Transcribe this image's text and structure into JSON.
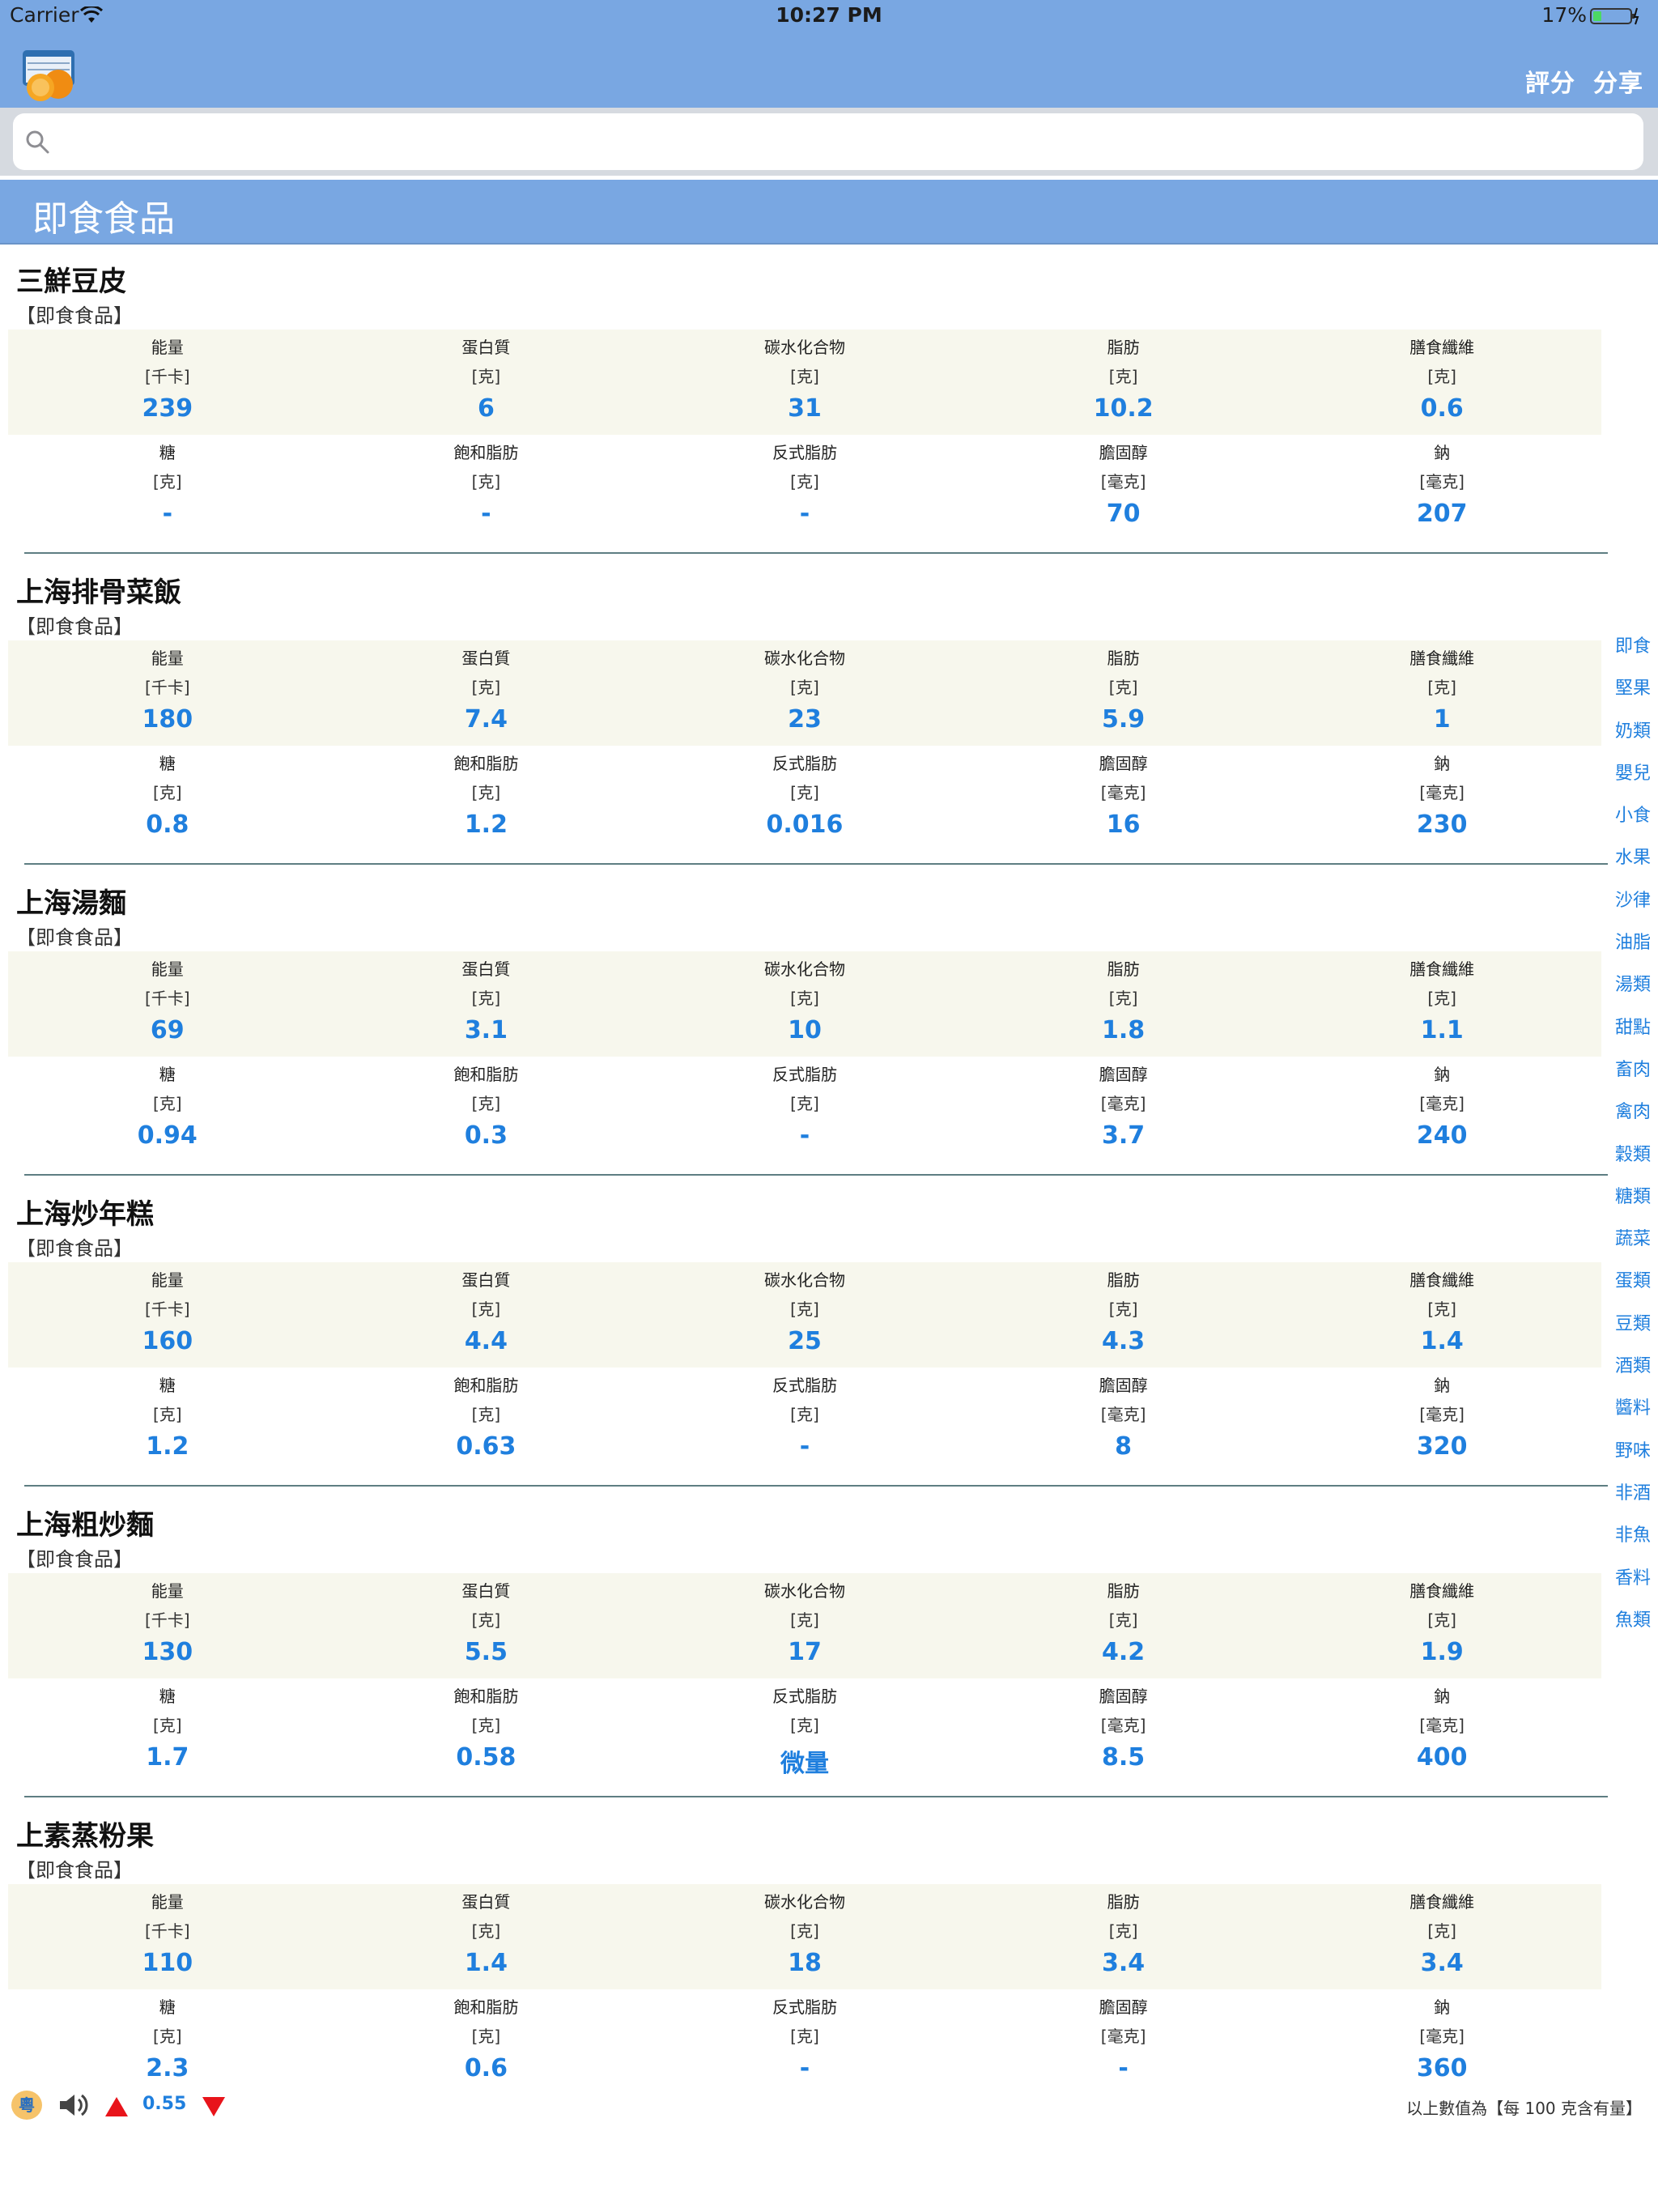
{
  "status": {
    "carrier": "Carrier",
    "time": "10:27 PM",
    "battery": "17%"
  },
  "nav": {
    "rate_label": "評分",
    "share_label": "分享"
  },
  "search": {
    "placeholder": ""
  },
  "section": {
    "title": "即食食品"
  },
  "labels": {
    "row1": [
      "能量",
      "蛋白質",
      "碳水化合物",
      "脂肪",
      "膳食纖維"
    ],
    "row1_units": [
      "[千卡]",
      "[克]",
      "[克]",
      "[克]",
      "[克]"
    ],
    "row2": [
      "糖",
      "飽和脂肪",
      "反式脂肪",
      "膽固醇",
      "鈉"
    ],
    "row2_units": [
      "[克]",
      "[克]",
      "[克]",
      "[毫克]",
      "[毫克]"
    ]
  },
  "items": [
    {
      "name": "三鮮豆皮",
      "category": "【即食食品】",
      "row1": [
        "239",
        "6",
        "31",
        "10.2",
        "0.6"
      ],
      "row2": [
        "-",
        "-",
        "-",
        "70",
        "207"
      ]
    },
    {
      "name": "上海排骨菜飯",
      "category": "【即食食品】",
      "row1": [
        "180",
        "7.4",
        "23",
        "5.9",
        "1"
      ],
      "row2": [
        "0.8",
        "1.2",
        "0.016",
        "16",
        "230"
      ]
    },
    {
      "name": "上海湯麵",
      "category": "【即食食品】",
      "row1": [
        "69",
        "3.1",
        "10",
        "1.8",
        "1.1"
      ],
      "row2": [
        "0.94",
        "0.3",
        "-",
        "3.7",
        "240"
      ]
    },
    {
      "name": "上海炒年糕",
      "category": "【即食食品】",
      "row1": [
        "160",
        "4.4",
        "25",
        "4.3",
        "1.4"
      ],
      "row2": [
        "1.2",
        "0.63",
        "-",
        "8",
        "320"
      ]
    },
    {
      "name": "上海粗炒麵",
      "category": "【即食食品】",
      "row1": [
        "130",
        "5.5",
        "17",
        "4.2",
        "1.9"
      ],
      "row2": [
        "1.7",
        "0.58",
        "微量",
        "8.5",
        "400"
      ]
    },
    {
      "name": "上素蒸粉果",
      "category": "【即食食品】",
      "row1": [
        "110",
        "1.4",
        "18",
        "3.4",
        "3.4"
      ],
      "row2": [
        "2.3",
        "0.6",
        "-",
        "-",
        "360"
      ]
    }
  ],
  "index": [
    "即食",
    "堅果",
    "奶類",
    "嬰兒",
    "小食",
    "水果",
    "沙律",
    "油脂",
    "湯類",
    "甜點",
    "畜肉",
    "禽肉",
    "穀類",
    "糖類",
    "蔬菜",
    "蛋類",
    "豆類",
    "酒類",
    "醬料",
    "野味",
    "非酒",
    "非魚",
    "香料",
    "魚類"
  ],
  "bottom": {
    "lang": "粵",
    "rate": "0.55",
    "footnote": "以上數值為【每 100 克含有量】"
  },
  "colors": {
    "header": "#79a7e2",
    "accent": "#1f7fde",
    "row_bg": "#f7f7ed"
  },
  "icons": [
    "wifi-icon",
    "battery-icon",
    "app-logo",
    "search-icon",
    "speaker-icon",
    "up-arrow-icon",
    "down-arrow-icon"
  ]
}
